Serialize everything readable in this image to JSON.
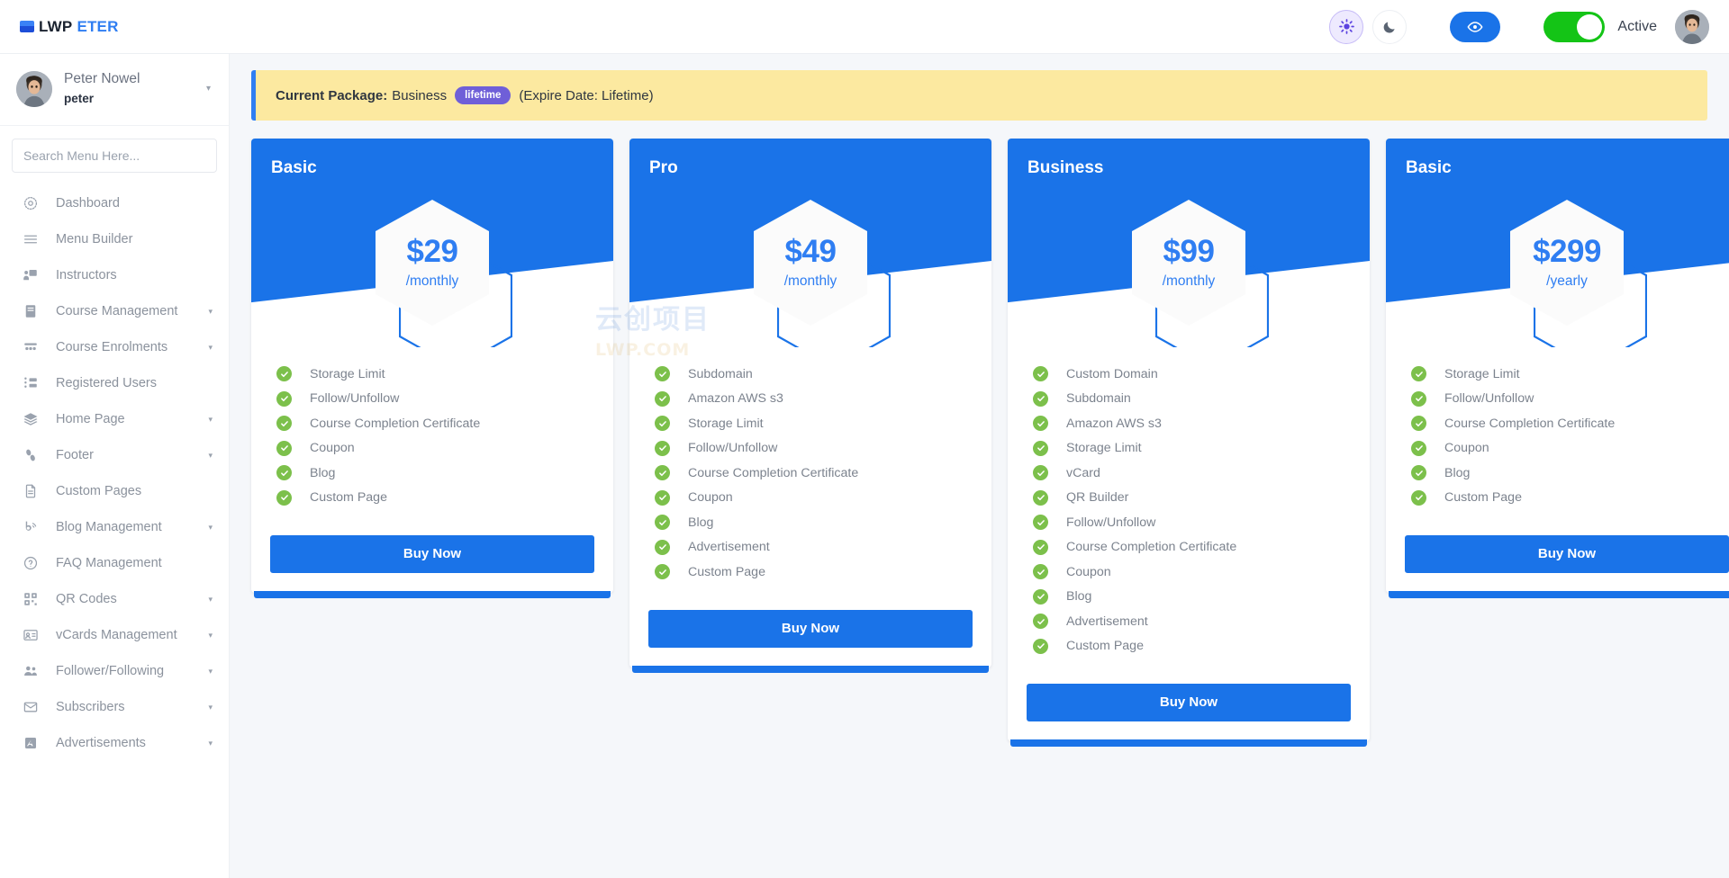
{
  "header": {
    "logo_dark": "LWP",
    "logo_blue": "ETER",
    "theme_light_icon": "sun-icon",
    "theme_dark_icon": "moon-icon",
    "preview_icon": "eye-icon",
    "status_label": "Active"
  },
  "sidebar": {
    "profile": {
      "name": "Peter Nowel",
      "username": "peter",
      "caret": "▾"
    },
    "search": {
      "placeholder": "Search Menu Here...",
      "value": ""
    },
    "items": [
      {
        "label": "Dashboard",
        "icon": "dashboard-icon",
        "caret": ""
      },
      {
        "label": "Menu Builder",
        "icon": "menu-icon",
        "caret": ""
      },
      {
        "label": "Instructors",
        "icon": "instructor-icon",
        "caret": ""
      },
      {
        "label": "Course Management",
        "icon": "book-icon",
        "caret": "▾"
      },
      {
        "label": "Course Enrolments",
        "icon": "group-icon",
        "caret": "▾"
      },
      {
        "label": "Registered Users",
        "icon": "userlist-icon",
        "caret": ""
      },
      {
        "label": "Home Page",
        "icon": "layers-icon",
        "caret": "▾"
      },
      {
        "label": "Footer",
        "icon": "footprint-icon",
        "caret": "▾"
      },
      {
        "label": "Custom Pages",
        "icon": "document-icon",
        "caret": ""
      },
      {
        "label": "Blog Management",
        "icon": "blog-icon",
        "caret": "▾"
      },
      {
        "label": "FAQ Management",
        "icon": "question-icon",
        "caret": ""
      },
      {
        "label": "QR Codes",
        "icon": "qrcode-icon",
        "caret": "▾"
      },
      {
        "label": "vCards Management",
        "icon": "idcard-icon",
        "caret": "▾"
      },
      {
        "label": "Follower/Following",
        "icon": "people-icon",
        "caret": "▾"
      },
      {
        "label": "Subscribers",
        "icon": "envelope-icon",
        "caret": "▾"
      },
      {
        "label": "Advertisements",
        "icon": "ad-icon",
        "caret": "▾"
      }
    ]
  },
  "alert": {
    "label": "Current Package:",
    "package": "Business",
    "badge": "lifetime",
    "expire": "(Expire Date: Lifetime)"
  },
  "watermark": {
    "top": "云创项目",
    "bottom": "LWP.COM"
  },
  "colors": {
    "primary": "#1a73e8",
    "price": "#2f7ef2",
    "check": "#7cc04b",
    "alert_bg": "#fce9a0",
    "badge": "#6f5fd8",
    "toggle_on": "#14c416"
  },
  "plans": [
    {
      "name": "Basic",
      "price": "$29",
      "period": "/monthly",
      "buy_label": "Buy Now",
      "features": [
        "Storage Limit",
        "Follow/Unfollow",
        "Course Completion Certificate",
        "Coupon",
        "Blog",
        "Custom Page"
      ]
    },
    {
      "name": "Pro",
      "price": "$49",
      "period": "/monthly",
      "buy_label": "Buy Now",
      "features": [
        "Subdomain",
        "Amazon AWS s3",
        "Storage Limit",
        "Follow/Unfollow",
        "Course Completion Certificate",
        "Coupon",
        "Blog",
        "Advertisement",
        "Custom Page"
      ]
    },
    {
      "name": "Business",
      "price": "$99",
      "period": "/monthly",
      "buy_label": "Buy Now",
      "features": [
        "Custom Domain",
        "Subdomain",
        "Amazon AWS s3",
        "Storage Limit",
        "vCard",
        "QR Builder",
        "Follow/Unfollow",
        "Course Completion Certificate",
        "Coupon",
        "Blog",
        "Advertisement",
        "Custom Page"
      ]
    },
    {
      "name": "Basic",
      "price": "$299",
      "period": "/yearly",
      "buy_label": "Buy Now",
      "features": [
        "Storage Limit",
        "Follow/Unfollow",
        "Course Completion Certificate",
        "Coupon",
        "Blog",
        "Custom Page"
      ]
    }
  ]
}
